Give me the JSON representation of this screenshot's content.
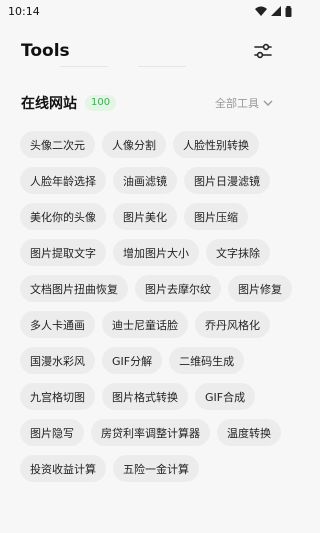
{
  "status_bar": {
    "time": "10:14"
  },
  "header": {
    "title": "Tools"
  },
  "section": {
    "title": "在线网站",
    "count": "100",
    "all_tools_label": "全部工具"
  },
  "tags": [
    "头像二次元",
    "人像分割",
    "人脸性别转换",
    "人脸年龄选择",
    "油画滤镜",
    "图片日漫滤镜",
    "美化你的头像",
    "图片美化",
    "图片压缩",
    "图片提取文字",
    "增加图片大小",
    "文字抹除",
    "文档图片扭曲恢复",
    "图片去摩尔纹",
    "图片修复",
    "多人卡通画",
    "迪士尼童话脸",
    "乔丹风格化",
    "国漫水彩风",
    "GIF分解",
    "二维码生成",
    "九宫格切图",
    "图片格式转换",
    "GIF合成",
    "图片隐写",
    "房贷利率调整计算器",
    "温度转换",
    "投资收益计算",
    "五险一金计算"
  ],
  "colors": {
    "badge_green": "#3fae4f",
    "tag_bg": "#ececec",
    "page_bg": "#f7f7f7"
  }
}
